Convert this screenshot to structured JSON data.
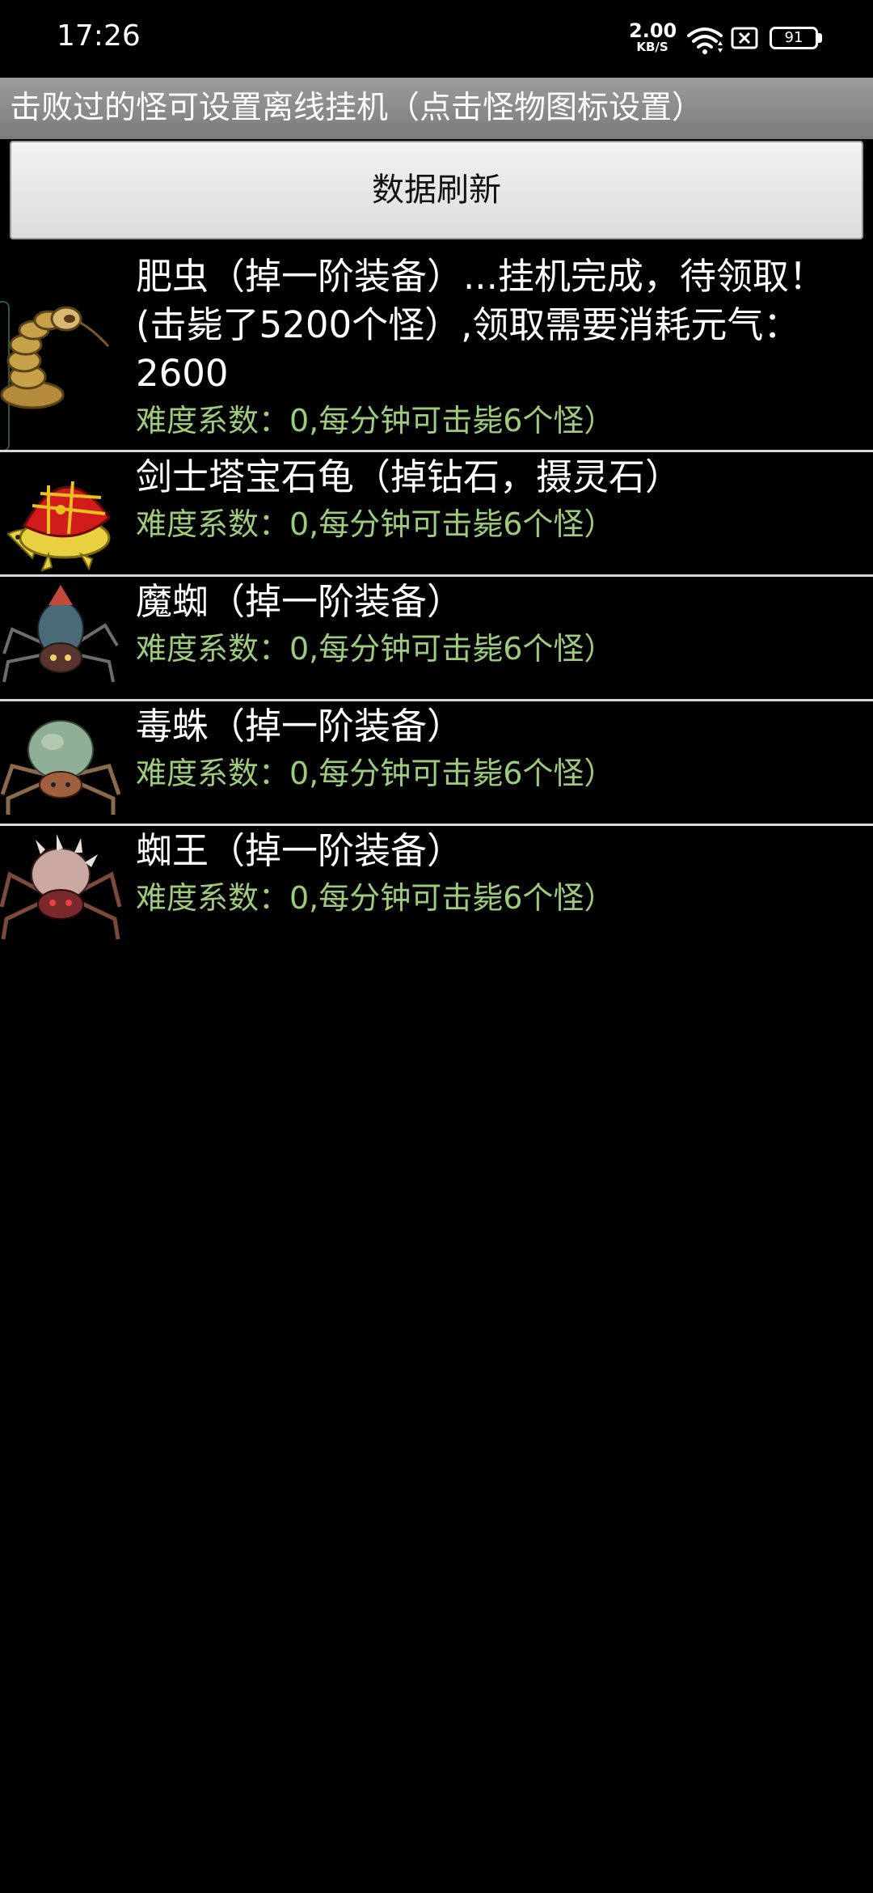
{
  "status_bar": {
    "time": "17:26",
    "net_speed_value": "2.00",
    "net_speed_unit": "KB/S",
    "battery": "91"
  },
  "banner": {
    "text": "击败过的怪可设置离线挂机（点击怪物图标设置）"
  },
  "refresh_button": {
    "label": "数据刷新"
  },
  "monsters": [
    {
      "name": "肥虫（掉一阶装备）...挂机完成，待领取！(击毙了5200个怪）,领取需要消耗元气：2600",
      "difficulty": "难度系数：0,每分钟可击毙6个怪）",
      "icon": "worm-icon"
    },
    {
      "name": "剑士塔宝石龟（掉钻石，摄灵石）",
      "difficulty": "难度系数：0,每分钟可击毙6个怪）",
      "icon": "turtle-icon"
    },
    {
      "name": "魔蜘（掉一阶装备）",
      "difficulty": "难度系数：0,每分钟可击毙6个怪）",
      "icon": "demon-spider-icon"
    },
    {
      "name": "毒蛛（掉一阶装备）",
      "difficulty": "难度系数：0,每分钟可击毙6个怪）",
      "icon": "poison-spider-icon"
    },
    {
      "name": "蜘王（掉一阶装备）",
      "difficulty": "难度系数：0,每分钟可击毙6个怪）",
      "icon": "spider-king-icon"
    }
  ]
}
